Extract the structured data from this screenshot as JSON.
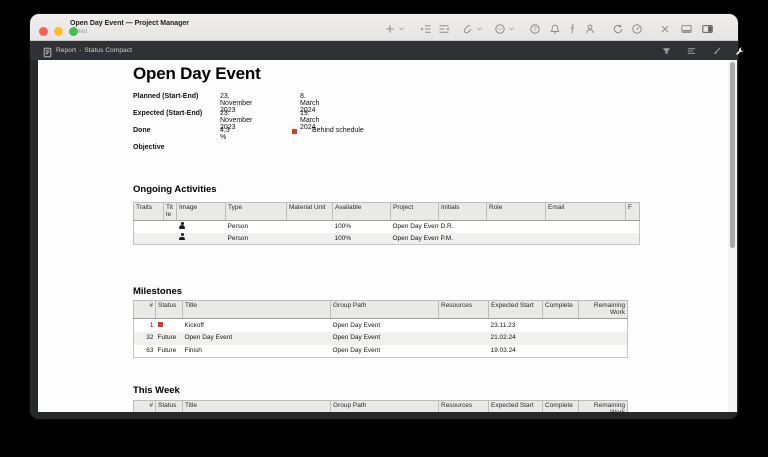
{
  "colors": {
    "status_red": "#e0392e",
    "accent_active": "#e9e9e9"
  },
  "window": {
    "title": "Open Day Event — Project Manager",
    "edited": "Edited",
    "titlebar_icons": [
      "add-icon",
      "add-chevron-icon",
      "indent-icon",
      "outdent-icon",
      "attach-icon",
      "attach-chevron-icon",
      "more-circle-icon",
      "more-chevron-icon",
      "help-icon",
      "notifications-bell-icon",
      "flag-icon",
      "person-resources-icon",
      "sync-icon",
      "gauge-icon",
      "close-x-icon",
      "bottom-panel-icon",
      "right-panel-icon"
    ],
    "darkbar_icons": [
      "report-page-icon",
      "filter-funnel-icon",
      "outline-lines-icon",
      "style-brush-icon",
      "settings-wrench-icon"
    ]
  },
  "breadcrumb": {
    "item1": "Report",
    "separator": "›",
    "item2": "Status Compact"
  },
  "report": {
    "title": "Open Day Event",
    "fields": [
      {
        "label": "Planned (Start-End)",
        "value1": "23. November 2023",
        "value2": "8. March 2024"
      },
      {
        "label": "Expected (Start-End)",
        "value1": "23. November 2023",
        "value2": "19. March 2024"
      },
      {
        "label": "Done",
        "value1": "4,3 %",
        "status": "Behind schedule"
      },
      {
        "label": "Objective",
        "value1": "",
        "value2": ""
      }
    ],
    "sections": {
      "ongoing": "Ongoing Activities",
      "milestones": "Milestones",
      "this_week": "This Week"
    }
  },
  "tables": {
    "ongoing": {
      "columns": [
        "Traits",
        "Title",
        "Image",
        "Type",
        "Material Unit",
        "Available",
        "Project",
        "Initials",
        "Role",
        "Email",
        "F"
      ],
      "rows": [
        [
          "",
          "",
          "::person",
          "Person",
          "",
          "100%",
          "Open Day Event",
          "D.R.",
          "",
          "",
          ""
        ],
        [
          "",
          "",
          "::person",
          "Person",
          "",
          "100%",
          "Open Day Event",
          "P.M.",
          "",
          "",
          ""
        ]
      ]
    },
    "milestones": {
      "columns": [
        "#",
        "Status",
        "Title",
        "Group Path",
        "Resources",
        "Expected Start",
        "Complete",
        "Remaining Work"
      ],
      "rows": [
        [
          "1",
          "::redsq",
          "Kickoff",
          "Open Day Event",
          "",
          "23.11.23",
          "",
          ""
        ],
        [
          "32",
          "Future",
          "Open Day Event",
          "Open Day Event",
          "",
          "21.02.24",
          "",
          ""
        ],
        [
          "63",
          "Future",
          "Finish",
          "Open Day Event",
          "",
          "19.03.24",
          "",
          ""
        ]
      ]
    },
    "this_week": {
      "columns": [
        "#",
        "Status",
        "Title",
        "Group Path",
        "Resources",
        "Expected Start",
        "Complete",
        "Remaining Work"
      ],
      "rows": []
    }
  }
}
